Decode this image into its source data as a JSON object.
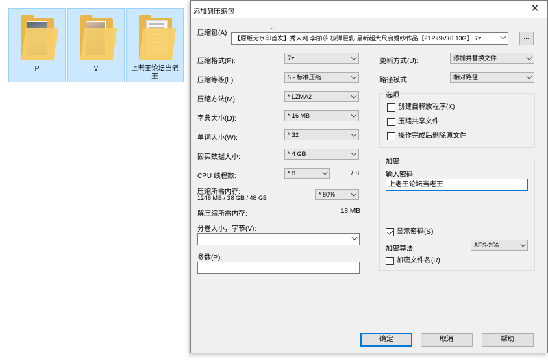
{
  "explorer": {
    "items": [
      {
        "label": "P"
      },
      {
        "label": "V"
      },
      {
        "label": "上老王论坛当老王"
      }
    ]
  },
  "dialog": {
    "title": "添加到压缩包",
    "archive": {
      "label": "压缩包(A)",
      "path_hint": "...",
      "value": "【原版无水印首发】秀人网 李丽莎 核弹巨乳 最新超大尺度婚纱作品【91P+9V+6.13G】.7z",
      "browse_label": "..."
    },
    "left": {
      "format": {
        "label": "压缩格式(F):",
        "value": "7z"
      },
      "level": {
        "label": "压缩等级(L):",
        "value": "5 - 标准压缩"
      },
      "method": {
        "label": "压缩方法(M):",
        "value": "* LZMA2"
      },
      "dict": {
        "label": "字典大小(D):",
        "value": "* 16 MB"
      },
      "word": {
        "label": "单词大小(W):",
        "value": "* 32"
      },
      "solid": {
        "label": "固实数据大小:",
        "value": "* 4 GB"
      },
      "threads": {
        "label": "CPU 线程数:",
        "value": "* 8",
        "total": "/ 8"
      },
      "mem_compress": {
        "label": "压缩所需内存:",
        "detail": "1248 MB / 38 GB / 48 GB",
        "value": "* 80%"
      },
      "mem_decompress": {
        "label": "解压缩所需内存:",
        "value": "18 MB"
      },
      "volume": {
        "label": "分卷大小，字节(V):",
        "value": ""
      },
      "params": {
        "label": "参数(P):",
        "value": ""
      }
    },
    "right": {
      "update": {
        "label": "更新方式(U):",
        "value": "添加并替换文件"
      },
      "pathmode": {
        "label": "路径模式",
        "value": "相对路径"
      },
      "options": {
        "title": "选项",
        "sfx": {
          "label": "创建自释放程序(X)",
          "checked": false
        },
        "shared": {
          "label": "压缩共享文件",
          "checked": false
        },
        "delete": {
          "label": "操作完成后删除源文件",
          "checked": false
        }
      },
      "encryption": {
        "title": "加密",
        "password_label": "输入密码:",
        "password_value": "上老王论坛当老王",
        "show_password": {
          "label": "显示密码(S)",
          "checked": true
        },
        "algo_label": "加密算法:",
        "algo_value": "AES-256",
        "encrypt_names": {
          "label": "加密文件名(R)",
          "checked": false
        }
      }
    },
    "buttons": {
      "ok": "确定",
      "cancel": "取消",
      "help": "帮助"
    }
  }
}
